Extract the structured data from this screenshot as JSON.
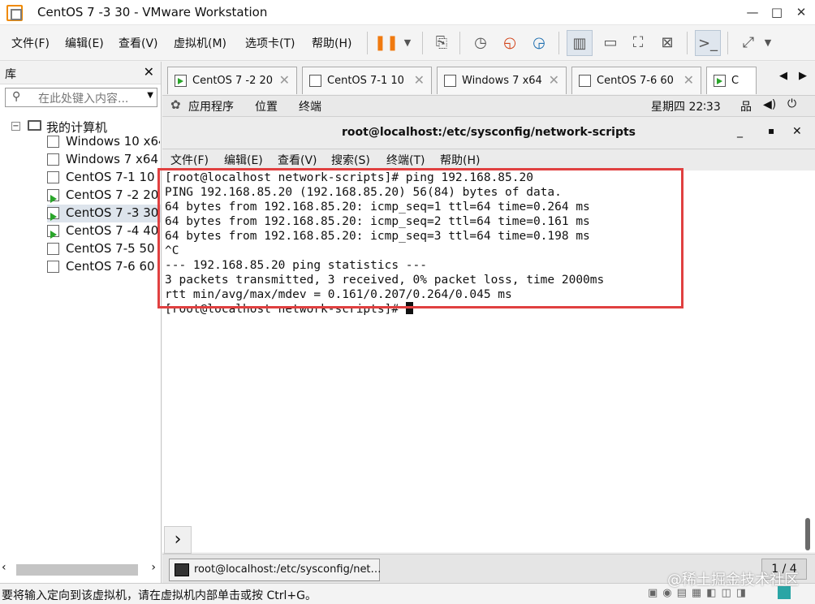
{
  "window": {
    "title": "CentOS 7 -3 30 - VMware Workstation",
    "min": "—",
    "max": "□",
    "close": "✕"
  },
  "menu": {
    "file": "文件(F)",
    "edit": "编辑(E)",
    "view": "查看(V)",
    "vm": "虚拟机(M)",
    "tabs": "选项卡(T)",
    "help": "帮助(H)"
  },
  "library": {
    "title": "库",
    "close": "✕",
    "search_placeholder": "在此处键入内容...",
    "root": "我的计算机",
    "items": [
      {
        "label": "Windows 10 x64",
        "running": false
      },
      {
        "label": "Windows 7 x64",
        "running": false
      },
      {
        "label": "CentOS 7-1  10",
        "running": false
      },
      {
        "label": "CentOS 7 -2 20",
        "running": true
      },
      {
        "label": "CentOS 7 -3 30",
        "running": true,
        "selected": true
      },
      {
        "label": "CentOS 7 -4 40",
        "running": true
      },
      {
        "label": "CentOS 7-5 50",
        "running": false
      },
      {
        "label": "CentOS 7-6  60",
        "running": false
      }
    ]
  },
  "tabs": [
    {
      "label": "CentOS 7 -2 20",
      "running": true
    },
    {
      "label": "CentOS 7-1  10",
      "running": false
    },
    {
      "label": "Windows 7 x64",
      "running": false
    },
    {
      "label": "CentOS 7-6  60",
      "running": false
    },
    {
      "label": "C",
      "running": true,
      "active": true
    }
  ],
  "gnome": {
    "apps": "应用程序",
    "places": "位置",
    "terminal": "终端",
    "clock": "星期四 22∶33"
  },
  "terminal_window": {
    "title": "root@localhost:/etc/sysconfig/network-scripts",
    "menu": {
      "file": "文件(F)",
      "edit": "编辑(E)",
      "view": "查看(V)",
      "search": "搜索(S)",
      "terminal": "终端(T)",
      "help": "帮助(H)"
    },
    "lines": [
      "[root@localhost network-scripts]# ping 192.168.85.20",
      "PING 192.168.85.20 (192.168.85.20) 56(84) bytes of data.",
      "64 bytes from 192.168.85.20: icmp_seq=1 ttl=64 time=0.264 ms",
      "64 bytes from 192.168.85.20: icmp_seq=2 ttl=64 time=0.161 ms",
      "64 bytes from 192.168.85.20: icmp_seq=3 ttl=64 time=0.198 ms",
      "^C",
      "--- 192.168.85.20 ping statistics ---",
      "3 packets transmitted, 3 received, 0% packet loss, time 2000ms",
      "rtt min/avg/max/mdev = 0.161/0.207/0.264/0.045 ms"
    ],
    "prompt": "[root@localhost network-scripts]# "
  },
  "taskbar": {
    "item": "root@localhost:/etc/sysconfig/net…",
    "pager": "1 / 4"
  },
  "status": {
    "text": "要将输入定向到该虚拟机，请在虚拟机内部单击或按 Ctrl+G。"
  },
  "watermark": "@稀土掘金技术社区"
}
